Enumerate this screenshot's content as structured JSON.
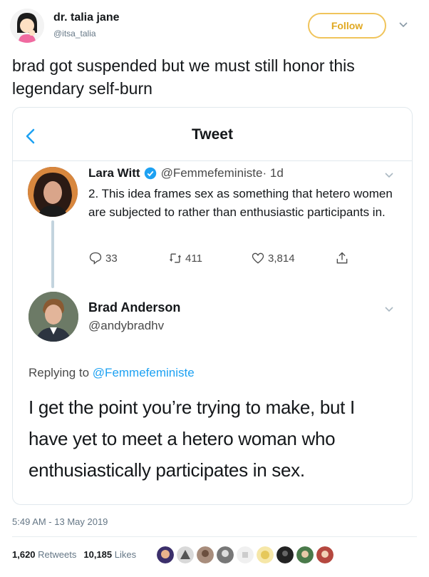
{
  "author": {
    "name": "dr. talia jane",
    "handle": "@itsa_talia",
    "follow_label": "Follow"
  },
  "tweet_text": "brad got suspended but we must still honor this legendary self-burn",
  "embedded": {
    "title": "Tweet",
    "original": {
      "name": "Lara Witt",
      "handle": "@Femmefeministe",
      "time": "· 1d",
      "text": "2. This idea frames sex as something that hetero women are subjected to rather than enthusiastic participants in.",
      "replies": "33",
      "retweets": "411",
      "likes": "3,814"
    },
    "reply": {
      "name": "Brad Anderson",
      "handle": "@andybradhv",
      "replying_prefix": "Replying to",
      "replying_to": "@Femmefeministe",
      "text": "I get the point you’re trying to make, but I have yet to meet a hetero woman who enthusiastically participates in sex."
    }
  },
  "timestamp": "5:49 AM - 13 May 2019",
  "stats": {
    "retweets_count": "1,620",
    "retweets_label": "Retweets",
    "likes_count": "10,185",
    "likes_label": "Likes"
  },
  "colors": {
    "accent": "#1da1f2",
    "follow_border": "#f0c45b"
  }
}
